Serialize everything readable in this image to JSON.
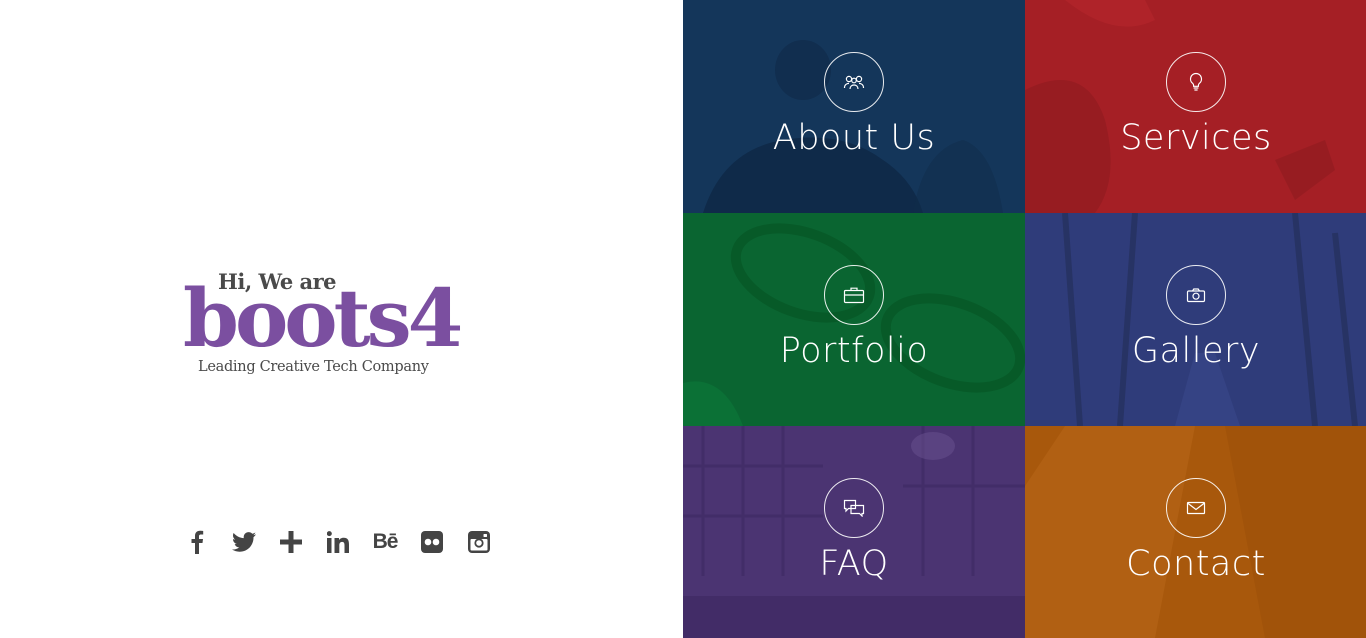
{
  "brand": {
    "greeting": "Hi, We are",
    "name": "boots4",
    "tagline": "Leading Creative Tech Company",
    "color": "#7b4fa0"
  },
  "social": [
    {
      "name": "facebook",
      "icon": "facebook-icon"
    },
    {
      "name": "twitter",
      "icon": "twitter-icon"
    },
    {
      "name": "google-plus",
      "icon": "plus-icon"
    },
    {
      "name": "linkedin",
      "icon": "linkedin-icon"
    },
    {
      "name": "behance",
      "icon": "behance-icon",
      "glyph": "Bē"
    },
    {
      "name": "flickr",
      "icon": "flickr-icon"
    },
    {
      "name": "instagram",
      "icon": "instagram-icon"
    }
  ],
  "tiles": [
    {
      "label": "About Us",
      "icon": "team-icon",
      "color": "#14365a"
    },
    {
      "label": "Services",
      "icon": "lightbulb-icon",
      "color": "#a51f25"
    },
    {
      "label": "Portfolio",
      "icon": "briefcase-icon",
      "color": "#0a6531"
    },
    {
      "label": "Gallery",
      "icon": "camera-icon",
      "color": "#2f3c7a"
    },
    {
      "label": "FAQ",
      "icon": "chat-icon",
      "color": "#4b3472"
    },
    {
      "label": "Contact",
      "icon": "envelope-icon",
      "color": "#a8580c"
    }
  ]
}
